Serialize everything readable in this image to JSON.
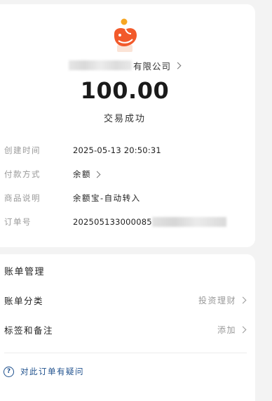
{
  "receipt": {
    "merchant_suffix": "有限公司",
    "amount": "100.00",
    "status": "交易成功"
  },
  "details": [
    {
      "label": "创建时间",
      "value": "2025-05-13 20:50:31"
    },
    {
      "label": "付款方式",
      "value": "余额"
    },
    {
      "label": "商品说明",
      "value": "余额宝-自动转入"
    },
    {
      "label": "订单号",
      "value": "202505133000085"
    }
  ],
  "management": {
    "title": "账单管理",
    "category_label": "账单分类",
    "category_value": "投资理财",
    "tags_label": "标签和备注",
    "tags_value": "添加",
    "question_text": "对此订单有疑问"
  },
  "colors": {
    "brand_orange": "#f25a2b",
    "accent_yellow": "#f6a623",
    "link_blue": "#1d4f8c"
  },
  "icons": {
    "logo": "orange-fish-logo-icon",
    "chevron": "chevron-right-icon",
    "question": "question-circle-icon"
  }
}
